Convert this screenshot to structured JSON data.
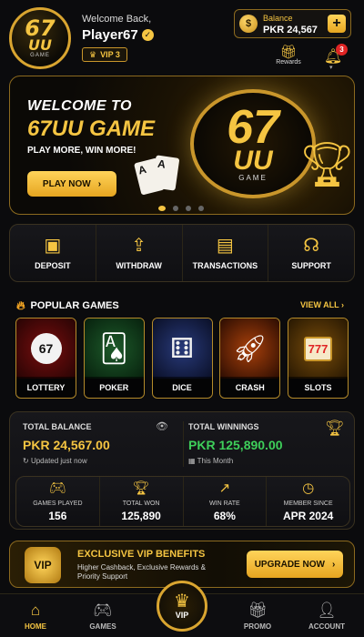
{
  "header": {
    "logo_top": "67",
    "logo_bottom": "UU",
    "logo_sub": "GAME",
    "welcome": "Welcome Back,",
    "username": "Player67",
    "vip_label": "VIP 3",
    "balance_label": "Balance",
    "balance_value": "PKR 24,567",
    "rewards_label": "Rewards",
    "notification_count": "3"
  },
  "banner": {
    "line1": "WELCOME TO",
    "line2": "67UU GAME",
    "tagline": "PLAY MORE, WIN MORE!",
    "cta": "PLAY NOW",
    "emblem_top": "67",
    "emblem_bottom": "UU",
    "emblem_sub": "GAME",
    "card1": "A",
    "card2": "A"
  },
  "actions": [
    {
      "label": "DEPOSIT",
      "icon": "wallet-icon"
    },
    {
      "label": "WITHDRAW",
      "icon": "upload-icon"
    },
    {
      "label": "TRANSACTIONS",
      "icon": "clipboard-icon"
    },
    {
      "label": "SUPPORT",
      "icon": "headset-icon"
    }
  ],
  "popular": {
    "title": "POPULAR GAMES",
    "view_all": "VIEW ALL",
    "games": [
      {
        "name": "LOTTERY",
        "art": "lottery-balls",
        "badge": "67"
      },
      {
        "name": "POKER",
        "art": "playing-cards"
      },
      {
        "name": "DICE",
        "art": "dice"
      },
      {
        "name": "CRASH",
        "art": "rocket"
      },
      {
        "name": "SLOTS",
        "art": "slot-machine",
        "badge": "777"
      }
    ]
  },
  "stats": {
    "total_balance_label": "TOTAL BALANCE",
    "total_balance_value": "PKR 24,567.00",
    "updated": "Updated just now",
    "total_winnings_label": "TOTAL WINNINGS",
    "total_winnings_value": "PKR 125,890.00",
    "winnings_period": "This Month",
    "metrics": [
      {
        "label": "GAMES PLAYED",
        "value": "156",
        "icon": "gamepad-icon"
      },
      {
        "label": "TOTAL WON",
        "value": "125,890",
        "icon": "trophy-icon"
      },
      {
        "label": "WIN RATE",
        "value": "68%",
        "icon": "trend-up-icon"
      },
      {
        "label": "MEMBER SINCE",
        "value": "APR 2024",
        "icon": "clock-icon"
      }
    ]
  },
  "vip_benefits": {
    "shield_label": "VIP",
    "title": "EXCLUSIVE VIP BENEFITS",
    "description": "Higher Cashback, Exclusive Rewards & Priority Support",
    "cta": "UPGRADE NOW"
  },
  "nav": {
    "home": "HOME",
    "games": "GAMES",
    "vip": "VIP",
    "promo": "PROMO",
    "account": "ACCOUNT"
  },
  "colors": {
    "accent": "#f5c542",
    "background": "#0b0b0d",
    "winnings_green": "#3ecf5a",
    "notification_red": "#e02424"
  }
}
